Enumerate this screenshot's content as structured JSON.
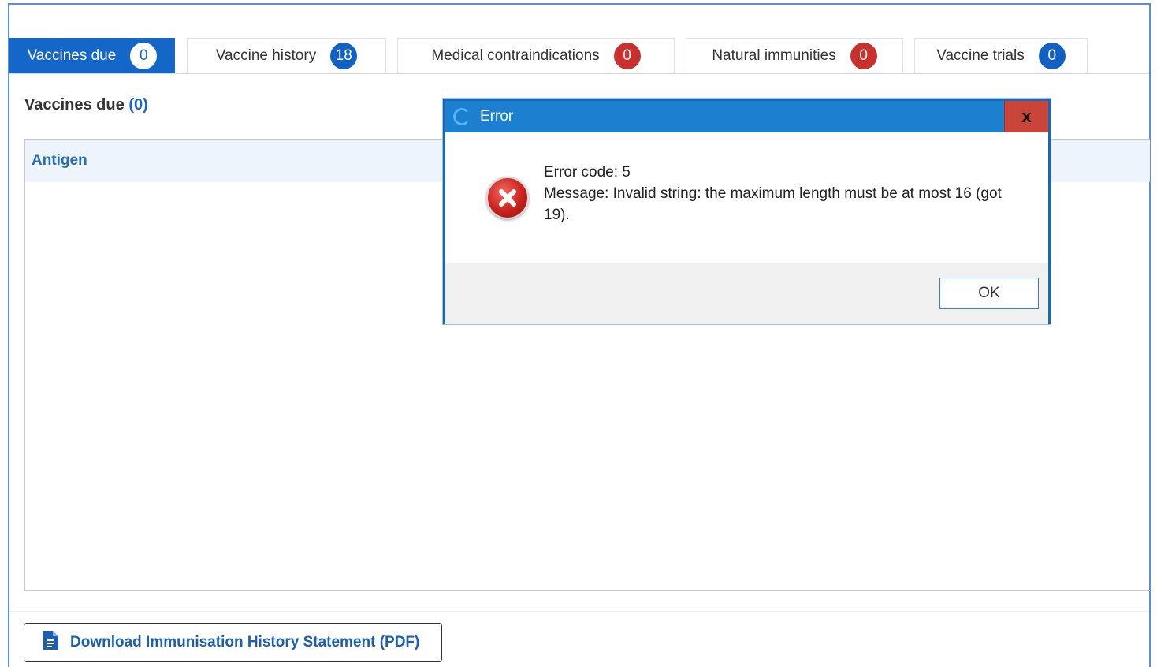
{
  "tabs": [
    {
      "label": "Vaccines due",
      "count": "0",
      "active": true,
      "badge_color": "#ffffff"
    },
    {
      "label": "Vaccine history",
      "count": "18",
      "active": false,
      "badge_color": "#1161c4"
    },
    {
      "label": "Medical contraindications",
      "count": "0",
      "active": false,
      "badge_color": "#c8312d"
    },
    {
      "label": "Natural immunities",
      "count": "0",
      "active": false,
      "badge_color": "#c8312d"
    },
    {
      "label": "Vaccine trials",
      "count": "0",
      "active": false,
      "badge_color": "#1161c4"
    }
  ],
  "section": {
    "title": "Vaccines due",
    "count_open": "(",
    "count": "0",
    "count_close": ")"
  },
  "table": {
    "columns": [
      "Antigen"
    ]
  },
  "download_button": {
    "label": "Download Immunisation History Statement (PDF)",
    "icon": "pdf-document-icon"
  },
  "dialog": {
    "title": "Error",
    "close_label": "x",
    "icon": "error-icon",
    "error_code_line": "Error code: 5",
    "message_line": "Message: Invalid string: the maximum length must be at most 16 (got 19).",
    "ok_label": "OK"
  },
  "colors": {
    "accent": "#1566c9",
    "danger": "#c8312d",
    "titlebar": "#1d7fcf"
  }
}
